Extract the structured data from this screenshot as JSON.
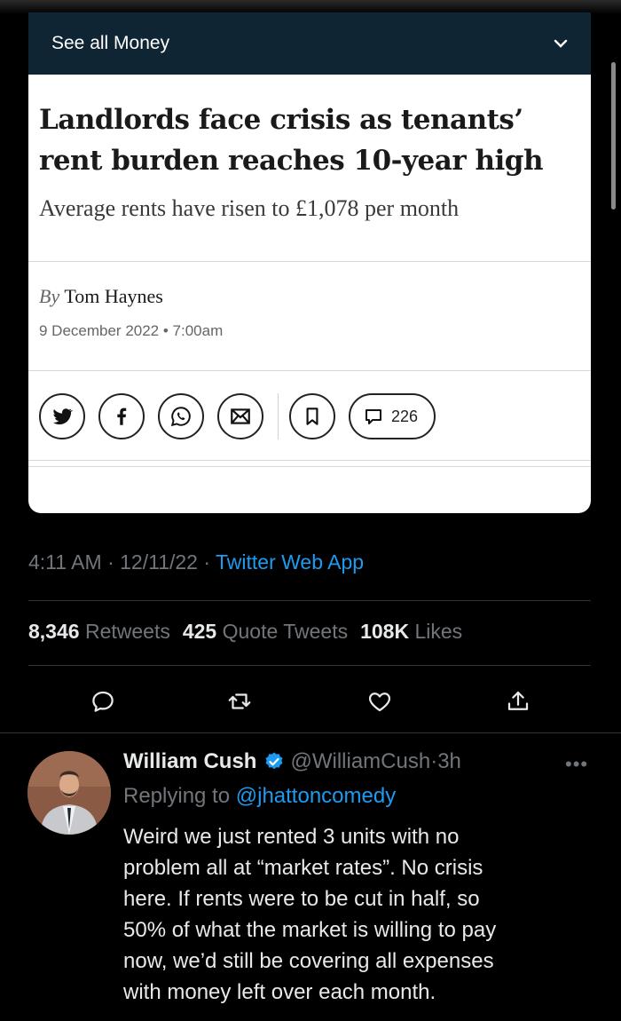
{
  "article_card": {
    "section_label": "See all Money",
    "headline": "Landlords face crisis as tenants’ rent burden reaches 10-year high",
    "standfirst": "Average rents have risen to £1,078 per month",
    "byline_prefix": "By",
    "author": "Tom Haynes",
    "date": "9 December 2022 • 7:00am",
    "comment_count": "226",
    "share_icons": [
      "twitter-icon",
      "facebook-icon",
      "whatsapp-icon",
      "email-icon",
      "bookmark-icon",
      "comment-icon"
    ]
  },
  "tweet": {
    "time": "4:11 AM",
    "date": "12/11/22",
    "source": "Twitter Web App",
    "retweets": "8,346",
    "retweets_label": "Retweets",
    "quotes": "425",
    "quotes_label": "Quote Tweets",
    "likes": "108K",
    "likes_label": "Likes",
    "action_icons": [
      "reply-icon",
      "retweet-icon",
      "like-icon",
      "share-icon"
    ]
  },
  "reply": {
    "name": "William Cush",
    "handle": "@WilliamCush",
    "age": "3h",
    "replying_prefix": "Replying to",
    "replying_to": "@jhattoncomedy",
    "text": "Weird we just rented 3 units with no\nproblem all at “market rates”.  No crisis\nhere.  If rents were to be cut in half, so\n50% of what the market is willing to pay\nnow, we’d still be covering all expenses\nwith money left over each month."
  },
  "colors": {
    "background": "#000000",
    "section_bar": "#0f2533",
    "link_blue": "#1d9bf0",
    "muted": "#71767b"
  }
}
